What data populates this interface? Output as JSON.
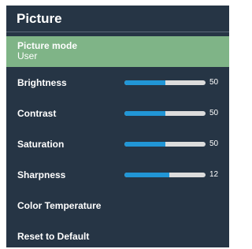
{
  "title": "Picture",
  "menu": {
    "picture_mode": {
      "label": "Picture mode",
      "value": "User"
    },
    "brightness": {
      "label": "Brightness",
      "value": "50",
      "level": 0.5
    },
    "contrast": {
      "label": "Contrast",
      "value": "50",
      "level": 0.5
    },
    "saturation": {
      "label": "Saturation",
      "value": "50",
      "level": 0.5
    },
    "sharpness": {
      "label": "Sharpness",
      "value": "12",
      "level": 0.55
    },
    "color_temperature": {
      "label": "Color Temperature"
    },
    "reset": {
      "label": "Reset to Default"
    }
  },
  "colors": {
    "panel_bg": "#263545",
    "selected_bg": "#7fb487",
    "slider_fill": "#2196d6",
    "slider_track": "#dcdcdc"
  }
}
